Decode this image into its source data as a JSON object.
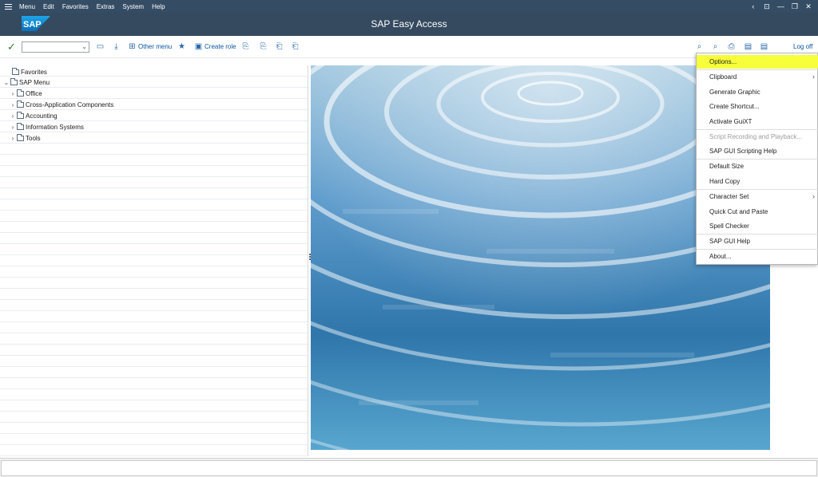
{
  "menubar": {
    "items": [
      "Menu",
      "Edit",
      "Favorites",
      "Extras",
      "System",
      "Help"
    ],
    "window_controls": [
      "‹",
      "⊡",
      "—",
      "❐",
      "✕"
    ]
  },
  "titlebar": {
    "title": "SAP Easy Access",
    "logo_text": "SAP"
  },
  "toolbar": {
    "command_field_value": "",
    "other_menu_label": "Other menu",
    "create_role_label": "Create role",
    "log_off_label": "Log off"
  },
  "tree": {
    "favorites": "Favorites",
    "sap_menu": "SAP Menu",
    "children": [
      "Office",
      "Cross-Application Components",
      "Accounting",
      "Information Systems",
      "Tools"
    ]
  },
  "dropdown": {
    "items": [
      {
        "label": "Options...",
        "highlighted": true,
        "disabled": false,
        "submenu": false
      },
      {
        "label": "Clipboard",
        "highlighted": false,
        "disabled": false,
        "submenu": true
      },
      {
        "label": "Generate Graphic",
        "highlighted": false,
        "disabled": false,
        "submenu": false
      },
      {
        "label": "Create Shortcut...",
        "highlighted": false,
        "disabled": false,
        "submenu": false
      },
      {
        "label": "Activate GuiXT",
        "highlighted": false,
        "disabled": false,
        "submenu": false
      },
      {
        "label": "Script Recording and Playback...",
        "highlighted": false,
        "disabled": true,
        "submenu": false
      },
      {
        "label": "SAP GUI Scripting Help",
        "highlighted": false,
        "disabled": false,
        "submenu": false
      },
      {
        "label": "Default Size",
        "highlighted": false,
        "disabled": false,
        "submenu": false
      },
      {
        "label": "Hard Copy",
        "highlighted": false,
        "disabled": false,
        "submenu": false
      },
      {
        "label": "Character Set",
        "highlighted": false,
        "disabled": false,
        "submenu": true
      },
      {
        "label": "Quick Cut and Paste",
        "highlighted": false,
        "disabled": false,
        "submenu": false
      },
      {
        "label": "Spell Checker",
        "highlighted": false,
        "disabled": false,
        "submenu": false
      },
      {
        "label": "SAP GUI Help",
        "highlighted": false,
        "disabled": false,
        "submenu": false
      },
      {
        "label": "About...",
        "highlighted": false,
        "disabled": false,
        "submenu": false
      }
    ]
  },
  "icons": {
    "check": "✓",
    "tree_expanded": "⌄",
    "tree_collapsed": "›",
    "submenu": "›",
    "dropdown_arrow": "⌄"
  },
  "colors": {
    "menubar_bg": "#344d64",
    "titlebar_bg": "#354a5f",
    "highlight": "#f6ff3a",
    "link": "#0a55a3"
  }
}
